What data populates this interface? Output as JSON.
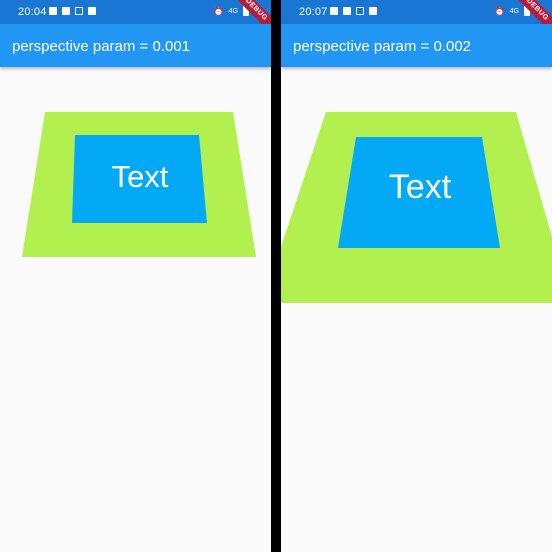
{
  "screens": [
    {
      "status": {
        "time": "20:04",
        "network": "4G"
      },
      "ribbon": "DEBUG",
      "title": "perspective param = 0.001",
      "card_text": "Text"
    },
    {
      "status": {
        "time": "20:07",
        "network": "4G"
      },
      "ribbon": "DEBUG",
      "title": "perspective param = 0.002",
      "card_text": "Text"
    }
  ],
  "colors": {
    "status_bar": "#1976d2",
    "app_bar": "#2196f3",
    "outer_container": "#b2f04f",
    "inner_container": "#03a9f4",
    "background": "#fafafa",
    "divider": "#000000"
  },
  "icons": [
    "alarm-icon",
    "signal-icon",
    "battery-icon",
    "notification-icon"
  ]
}
